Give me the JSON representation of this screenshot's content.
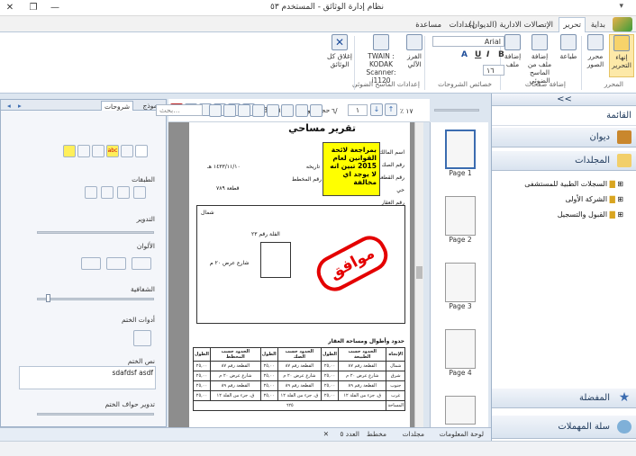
{
  "window": {
    "title": "نظام إدارة الوثائق - المستخدم ٥٣",
    "quick_access": "▾"
  },
  "ribbon_tabs": [
    "بداية",
    "تحرير",
    "الإتصالات الادارية (الديوان)",
    "إعدادات",
    "مساعدة"
  ],
  "ribbon": {
    "finish_edit": "إنهاء التحرير",
    "image_editor": "محرر الصور",
    "print": "طباعة",
    "add_file": "إضافة ملف",
    "add_scanner_file": "إضافة ملف من الماسح الضوئي",
    "group_pages": "إضافة صفحات",
    "group_editor": "المحرر",
    "font_name": "Arial",
    "font_size": "١٦",
    "group_annotations": "خصائص الشروحات",
    "auto_sort": "الفرز الآلي",
    "twain": "TWAIN : KODAK Scanner: i1120",
    "group_scanner": "إعدادات الماسح الضوئي",
    "close_docs": "إغلاق كل الوثائق",
    "fmt_bold": "B",
    "fmt_italic": "I",
    "fmt_underline": "U",
    "fmt_a": "A"
  },
  "left_panel": {
    "tabs": [
      "شروحات",
      "نموذج"
    ],
    "layers": "الطبقات",
    "rotate": "التدوير",
    "colors": "الألوان",
    "transparency": "الشفافية",
    "stamp_tools": "أدوات الختم",
    "stamp_text_label": "نص الختم",
    "stamp_text_value": "sdafdsf asdf",
    "stamp_edges_rotate": "تدوير حواف الختم",
    "transparency_level": 0.08,
    "rotate_level": 0.0
  },
  "viewer": {
    "doc_size_label": "حجم الوثيقة",
    "doc_size_value": "KB ١٣٩,٦٨",
    "search_placeholder": "بحث...",
    "page_current": "١",
    "page_total": "٦/",
    "zoom": "٪ ١٧",
    "title_text": "الإدارة العامة للتخطيط",
    "title_text2": "تقرير مساحي",
    "note_text": "بمراجعة لائحة القوانين لعام 2015 تبين انه لا يوجد اي مخالفة",
    "stamp_text": "موافق",
    "doc_fields": [
      "اسم المالك",
      "رقم الصك",
      "تاريخه",
      "رقم القطعة",
      "رقم المخطط",
      "حي",
      "رقم العقار"
    ],
    "doc_values": [
      "١٤٣٣/١١/١٠ هـ",
      "٥/١٤٣٣/٦٢٠٠",
      "١٢٣٤٥٦",
      "٢٢٢٤٤٥٥٦٦",
      "قطعة ٧٨٩"
    ],
    "plan_labels": [
      "شمال",
      "الفلة رقم ٢٣",
      "شارع عرض ٢٠ م",
      "جزء من الفلة رقم ١٢"
    ],
    "table_title": "حدود وأطوال ومساحة العقار",
    "table_headers": [
      "الإتجاه",
      "الحدود حسب الطبيعة",
      "الطول",
      "الحدود حسب الصك",
      "الطول",
      "الحدود حسب المخطط",
      "الطول"
    ],
    "table_rows": [
      [
        "شمال",
        "القطعة رقم ٨٧",
        "٢٥,٠٠",
        "القطعة رقم ٨٧",
        "٢٥,٠٠",
        "القطعة رقم ٨٧",
        "٢٥,٠٠"
      ],
      [
        "شرق",
        "شارع عرض ٢٠ م",
        "٢٥,٠٠",
        "شارع عرض ٢٠ م",
        "٢٥,٠٠",
        "شارع عرض ٢٠ م",
        "٢٥,٠٠"
      ],
      [
        "جنوب",
        "القطعة رقم ٨٩",
        "٢٥,٠٠",
        "القطعة رقم ٨٩",
        "٢٥,٠٠",
        "القطعة رقم ٨٩",
        "٢٥,٠٠"
      ],
      [
        "غرب",
        "ق. جزء من الفلة ١٢",
        "٢٥,٠٠",
        "ق. جزء من الفلة ١٢",
        "٢٥,٠٠",
        "ق. جزء من الفلة ١٢",
        "٢٥,٠٠"
      ]
    ],
    "area_label": "المساحة",
    "area_value": "٦٢٥"
  },
  "thumbnails": [
    "Page 1",
    "Page 2",
    "Page 3",
    "Page 4"
  ],
  "right_panel": {
    "nav_toggle": "<<",
    "list_label": "القائمة",
    "diwan": "ديوان",
    "folders": "المجلدات",
    "tree": [
      "السجلات الطبية للمستشفى",
      "الشركة الأولى",
      "القبول والتسجيل"
    ],
    "favorites": "المفضلة",
    "trash": "سلة المهملات"
  },
  "status": {
    "info_panel": "لوحة المعلومات",
    "folders_tab": "مجلدات",
    "layout_label": "مخطط",
    "count_label": "العدد ٥"
  },
  "colors": {
    "accent": "#3b6cb0",
    "stamp": "#e40000",
    "note": "#ffff00"
  }
}
